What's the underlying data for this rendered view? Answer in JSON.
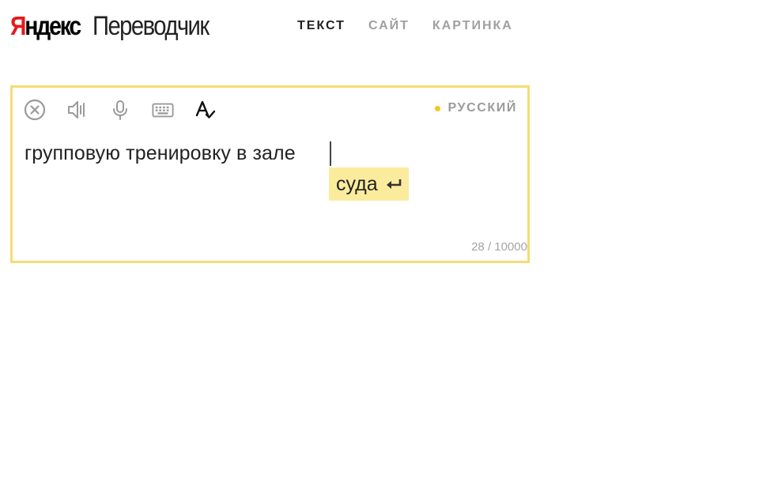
{
  "header": {
    "logo_brand_first": "Я",
    "logo_brand_rest": "ндекс",
    "logo_product": "Переводчик",
    "tabs": [
      {
        "label": "ТЕКСТ",
        "active": true
      },
      {
        "label": "САЙТ",
        "active": false
      },
      {
        "label": "КАРТИНКА",
        "active": false
      }
    ]
  },
  "translator": {
    "toolbar_icons": [
      "clear-icon",
      "speaker-icon",
      "microphone-icon",
      "keyboard-icon",
      "spellcheck-icon"
    ],
    "source_language": "РУССКИЙ",
    "input_text": "групповую тренировку в зале",
    "suggestion": "суда",
    "suggestion_icon": "enter-icon",
    "char_counter": "28 / 10000"
  },
  "colors": {
    "brand_red": "#e51a1a",
    "box_border": "#f5dc73",
    "suggestion_bg": "#fbec9d",
    "language_dot": "#f5c61f",
    "active_tab": "#222222",
    "inactive_tab": "#a0a0a0"
  }
}
